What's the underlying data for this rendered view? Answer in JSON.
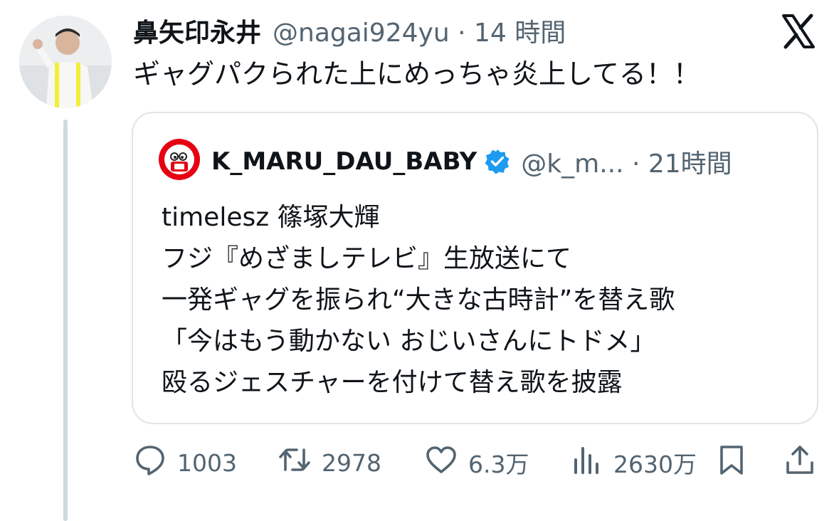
{
  "tweet": {
    "display_name": "鼻矢印永井",
    "meta": "@nagai924yu · 14 時間",
    "text": "ギャグパクられた上にめっちゃ炎上してる！！"
  },
  "quote": {
    "display_name": "K_MARU_DAU_BABY",
    "meta": "@k_m... · 21時間",
    "lines": [
      "timelesz 篠塚大輝",
      "フジ『めざましテレビ』生放送にて",
      "一発ギャグを振られ“大きな古時計”を替え歌",
      "「今はもう動かない おじいさんにトドメ」",
      "殴るジェスチャーを付けて替え歌を披露"
    ]
  },
  "actions": {
    "replies": "1003",
    "retweets": "2978",
    "likes": "6.3万",
    "views": "2630万"
  },
  "icons": {
    "reply": "speech-bubble-icon",
    "retweet": "retweet-arrows-icon",
    "like": "heart-icon",
    "views": "bar-chart-icon",
    "bookmark": "bookmark-icon",
    "share": "share-upload-icon",
    "platform": "x-logo-icon",
    "verified": "verified-badge-icon"
  },
  "colors": {
    "text_primary": "#0f1419",
    "text_secondary": "#536471",
    "verified_blue": "#1d9bf0",
    "quote_avatar_red": "#e60012"
  }
}
